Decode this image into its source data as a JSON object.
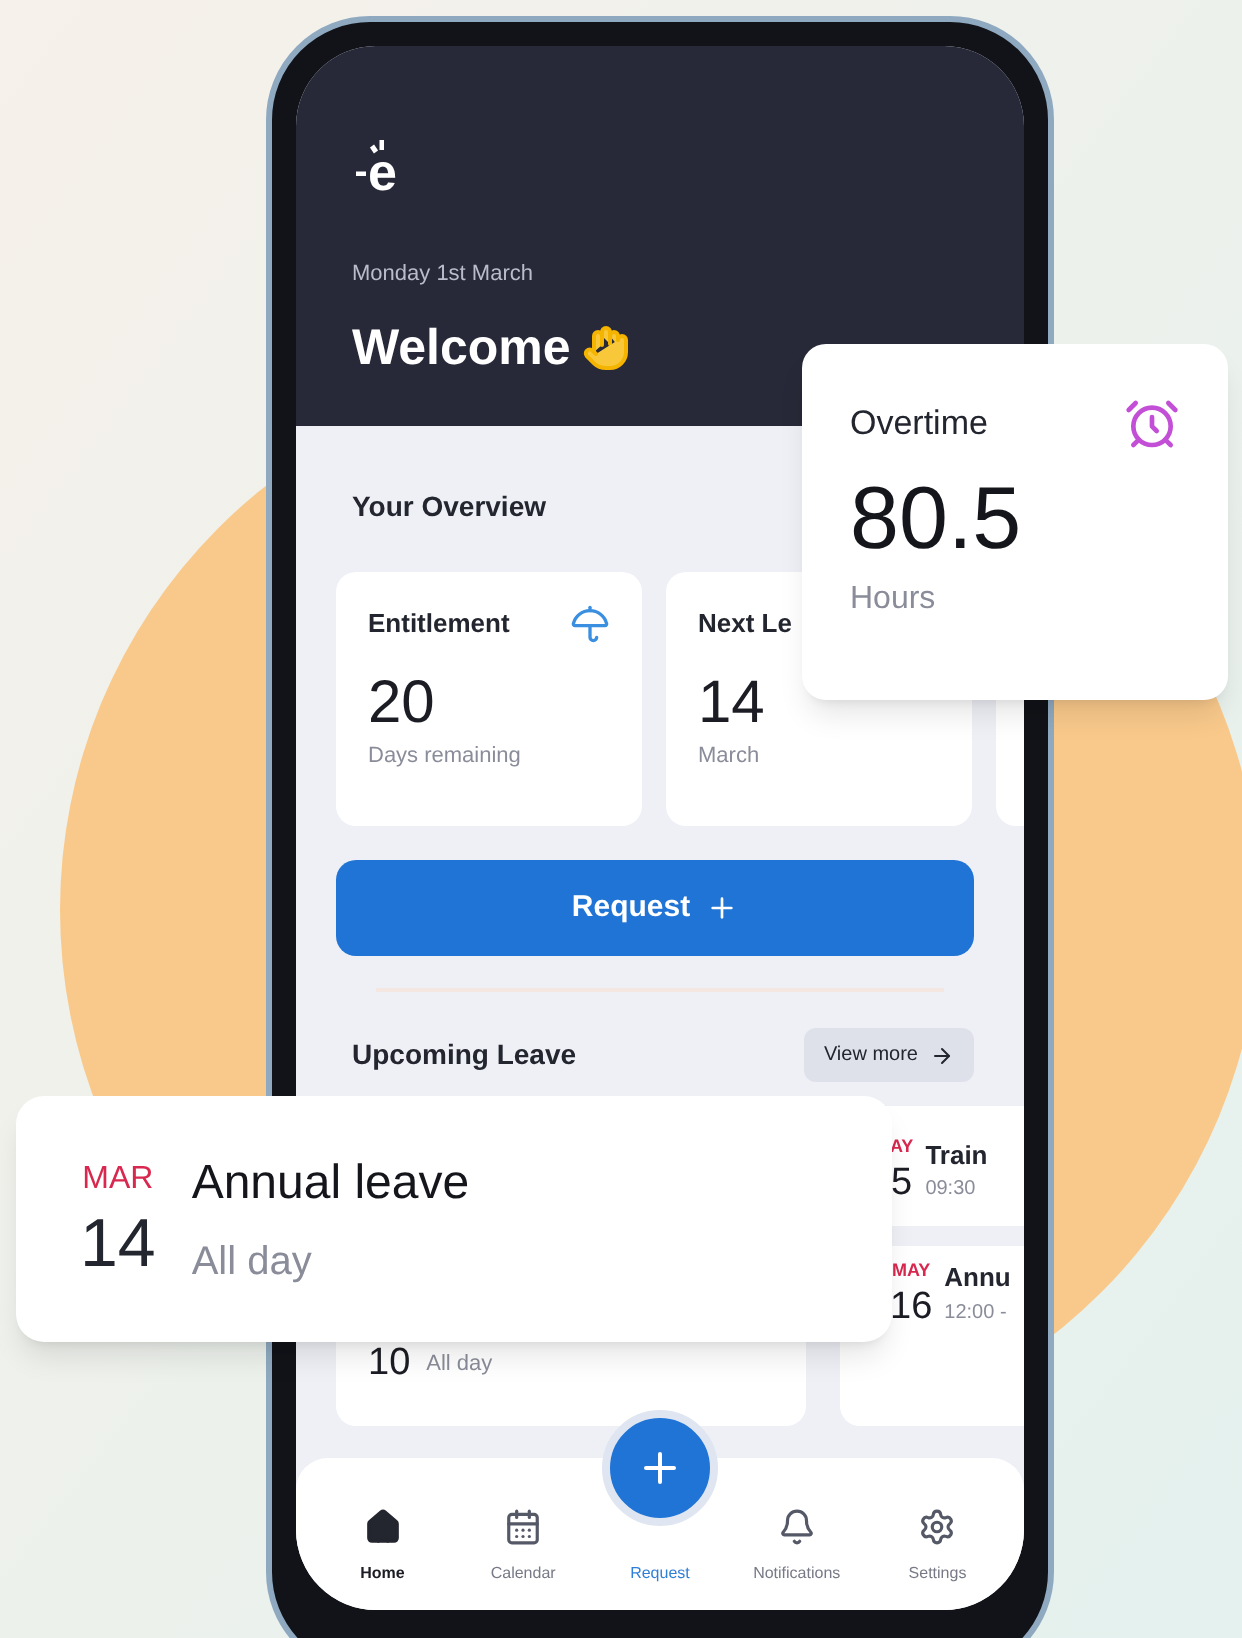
{
  "header": {
    "logo": "e",
    "date": "Monday 1st March",
    "greeting": "Welcome"
  },
  "overview": {
    "title": "Your Overview",
    "cards": [
      {
        "title": "Entitlement",
        "value": "20",
        "caption": "Days remaining"
      },
      {
        "title": "Next Le",
        "value": "14",
        "caption": "March"
      }
    ]
  },
  "request_button": {
    "label": "Request"
  },
  "upcoming": {
    "title": "Upcoming Leave",
    "view_more": "View more",
    "left_column": [
      {
        "day": "10",
        "time": "All day"
      }
    ],
    "right_column": [
      {
        "month": "AY",
        "day": "5",
        "title": "Train",
        "time": "09:30"
      },
      {
        "month": "MAY",
        "day": "16",
        "title": "Annu",
        "time": "12:00 -"
      }
    ]
  },
  "nav": [
    {
      "kind": "tab",
      "label": "Home",
      "selected": true
    },
    {
      "kind": "tab",
      "label": "Calendar",
      "selected": false
    },
    {
      "kind": "fab",
      "label": "Request",
      "selected": false
    },
    {
      "kind": "tab",
      "label": "Notifications",
      "selected": false
    },
    {
      "kind": "tab",
      "label": "Settings",
      "selected": false
    }
  ],
  "overtime_card": {
    "title": "Overtime",
    "value": "80.5",
    "unit": "Hours"
  },
  "leave_card": {
    "month": "MAR",
    "day": "14",
    "title": "Annual leave",
    "time": "All day"
  }
}
